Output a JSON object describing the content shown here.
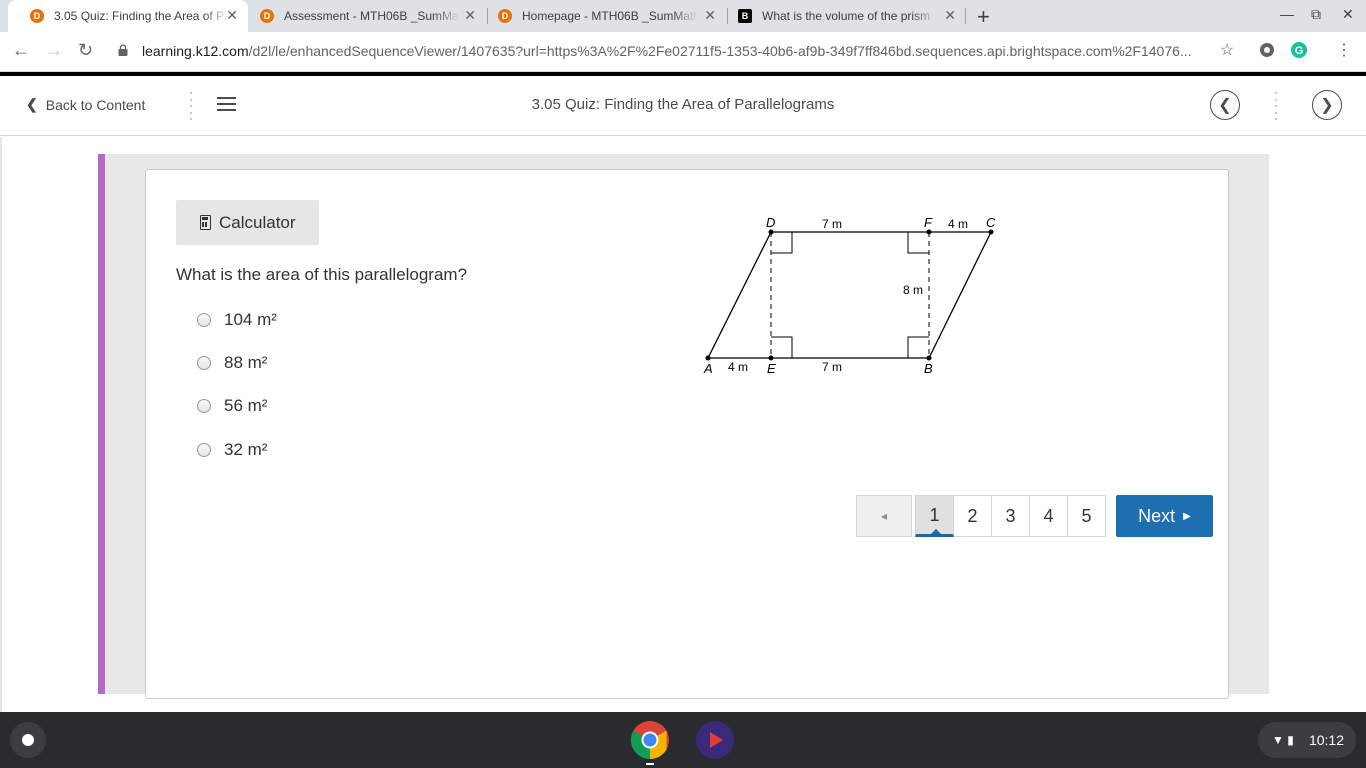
{
  "browser": {
    "tabs": [
      {
        "title": "3.05 Quiz: Finding the Area of Pa",
        "favicon": "brightspace-icon",
        "active": true
      },
      {
        "title": "Assessment - MTH06B _SumMat",
        "favicon": "brightspace-icon",
        "active": false
      },
      {
        "title": "Homepage - MTH06B _SumMath",
        "favicon": "brightspace-icon",
        "active": false
      },
      {
        "title": "What is the volume of the prism",
        "favicon": "brainly-icon",
        "active": false
      }
    ],
    "url_host": "learning.k12.com",
    "url_path": "/d2l/le/enhancedSequenceViewer/1407635?url=https%3A%2F%2Fe02711f5-1353-40b6-af9b-349f7ff846bd.sequences.api.brightspace.com%2F14076..."
  },
  "content_nav": {
    "back_label": "Back to Content",
    "title": "3.05 Quiz: Finding the Area of Parallelograms"
  },
  "quiz": {
    "calculator_label": "Calculator",
    "question": "What is the area of this parallelogram?",
    "options": [
      "104 m²",
      "88 m²",
      "56 m²",
      "32 m²"
    ]
  },
  "figure": {
    "points": {
      "A": "A",
      "B": "B",
      "C": "C",
      "D": "D",
      "E": "E",
      "F": "F"
    },
    "labels": {
      "top_dc": "7 m",
      "top_fc": "4 m",
      "height": "8 m",
      "bottom_ae": "4 m",
      "bottom_eb": "7 m"
    }
  },
  "pager": {
    "prev_label": "◂",
    "pages": [
      "1",
      "2",
      "3",
      "4",
      "5"
    ],
    "current": "1",
    "next_label": "Next"
  },
  "shelf": {
    "time": "10:12"
  },
  "colors": {
    "accent_purple": "#b467c8",
    "next_button": "#1e6fb0",
    "brightspace_orange": "#e8710a"
  }
}
